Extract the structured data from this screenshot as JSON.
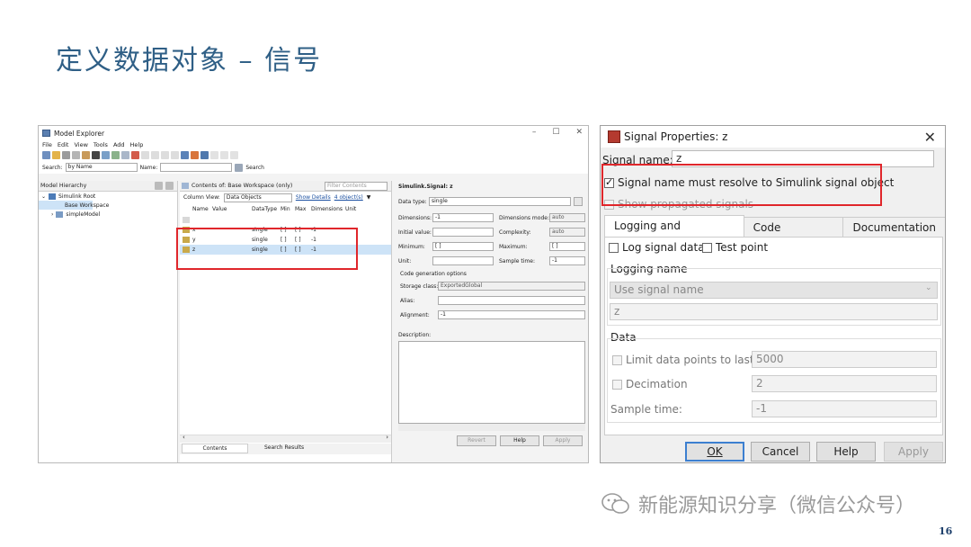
{
  "slide": {
    "title": "定义数据对象 – 信号",
    "page_number": "16",
    "watermark": "新能源知识分享（微信公众号）"
  },
  "model_explorer": {
    "title": "Model Explorer",
    "window_controls": [
      "–",
      "☐",
      "✕"
    ],
    "menu": [
      "File",
      "Edit",
      "View",
      "Tools",
      "Add",
      "Help"
    ],
    "search_label": "Search:",
    "search_by": "by Name",
    "name_label": "Name:",
    "search_button": "Search",
    "hierarchy_header": "Model Hierarchy",
    "tree": [
      "Simulink Root",
      "Base Workspace",
      "simpleModel"
    ],
    "contents_label": "Contents of: Base Workspace (only)",
    "filter_placeholder": "Filter Contents",
    "column_view_label": "Column View:",
    "column_view_value": "Data Objects",
    "show_details": "Show Details",
    "object_count": "4 object(s)",
    "columns": [
      "Name",
      "Value",
      "DataType",
      "Min",
      "Max",
      "Dimensions",
      "Unit"
    ],
    "rows": [
      {
        "name": "x",
        "datatype": "single",
        "min": "[ ]",
        "max": "[ ]",
        "dims": "-1"
      },
      {
        "name": "y",
        "datatype": "single",
        "min": "[ ]",
        "max": "[ ]",
        "dims": "-1"
      },
      {
        "name": "z",
        "datatype": "single",
        "min": "[ ]",
        "max": "[ ]",
        "dims": "-1"
      }
    ],
    "bottom_tabs": [
      "Contents",
      "Search Results"
    ],
    "props": {
      "header": "Simulink.Signal: z",
      "data_type_label": "Data type:",
      "data_type_value": "single",
      "dimensions_label": "Dimensions:",
      "dimensions_value": "-1",
      "dimensions_mode_label": "Dimensions mode:",
      "dimensions_mode_value": "auto",
      "initial_value_label": "Initial value:",
      "complexity_label": "Complexity:",
      "complexity_value": "auto",
      "minimum_label": "Minimum:",
      "minimum_value": "[ ]",
      "maximum_label": "Maximum:",
      "maximum_value": "[ ]",
      "unit_label": "Unit:",
      "sample_time_label": "Sample time:",
      "sample_time_value": "-1",
      "code_gen_label": "Code generation options",
      "storage_class_label": "Storage class:",
      "storage_class_value": "ExportedGlobal",
      "alias_label": "Alias:",
      "alignment_label": "Alignment:",
      "alignment_value": "-1",
      "description_label": "Description:",
      "revert": "Revert",
      "help": "Help",
      "apply": "Apply"
    }
  },
  "signal_properties": {
    "title": "Signal Properties: z",
    "close": "✕",
    "signal_name_label": "Signal name:",
    "signal_name_value": "z",
    "resolve_label": "Signal name must resolve to Simulink signal object",
    "resolve_checked": true,
    "show_propagated": "Show propagated signals",
    "tabs": [
      "Logging and accessibility",
      "Code Generation",
      "Documentation"
    ],
    "log_signal_data": "Log signal data",
    "test_point": "Test point",
    "logging_name_label": "Logging name",
    "logging_name_mode": "Use signal name",
    "logging_name_value": "z",
    "data_group": "Data",
    "limit_label": "Limit data points to last",
    "limit_value": "5000",
    "decimation_label": "Decimation",
    "decimation_value": "2",
    "sample_time_label": "Sample time:",
    "sample_time_value": "-1",
    "buttons": {
      "ok": "OK",
      "cancel": "Cancel",
      "help": "Help",
      "apply": "Apply"
    }
  },
  "colors": {
    "title": "#2f5f86",
    "highlight_box": "#e0262b",
    "selection": "#cde3f7",
    "default_button": "#3c7fd0"
  }
}
